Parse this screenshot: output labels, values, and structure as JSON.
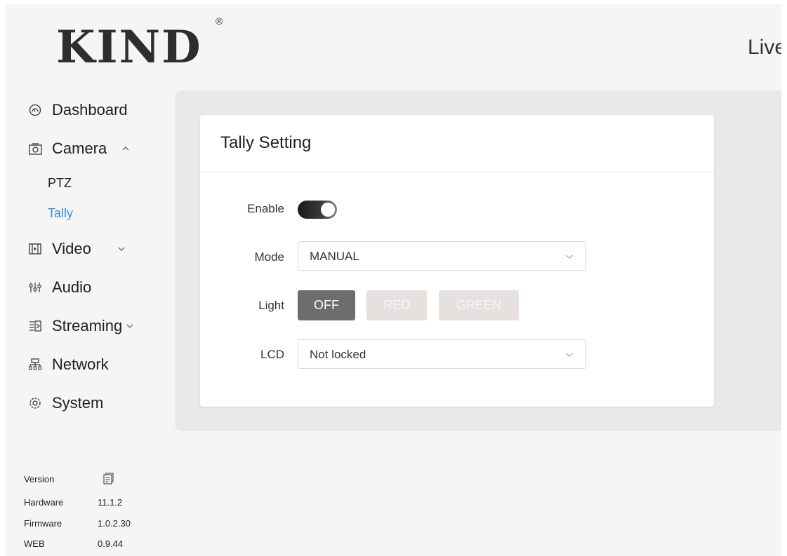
{
  "brand": {
    "name": "KIND",
    "reg": "®"
  },
  "header": {
    "right_text": "Live"
  },
  "sidebar": {
    "items": [
      {
        "label": "Dashboard",
        "icon": "dashboard-icon"
      },
      {
        "label": "Camera",
        "icon": "camera-icon",
        "expanded": true
      },
      {
        "label": "Video",
        "icon": "video-icon"
      },
      {
        "label": "Audio",
        "icon": "audio-icon"
      },
      {
        "label": "Streaming",
        "icon": "streaming-icon"
      },
      {
        "label": "Network",
        "icon": "network-icon"
      },
      {
        "label": "System",
        "icon": "gear-icon"
      }
    ],
    "camera_sub": [
      {
        "label": "PTZ",
        "active": false
      },
      {
        "label": "Tally",
        "active": true
      }
    ]
  },
  "version": {
    "label": "Version",
    "rows": [
      {
        "key": "Hardware",
        "value": "11.1.2"
      },
      {
        "key": "Firmware",
        "value": "1.0.2.30"
      },
      {
        "key": "WEB",
        "value": "0.9.44"
      }
    ]
  },
  "tally": {
    "title": "Tally Setting",
    "enable_label": "Enable",
    "enable_on": true,
    "mode_label": "Mode",
    "mode_value": "MANUAL",
    "light_label": "Light",
    "light_buttons": [
      "OFF",
      "RED",
      "GREEN"
    ],
    "light_selected": "OFF",
    "lcd_label": "LCD",
    "lcd_value": "Not locked"
  },
  "colors": {
    "accent": "#3a8fd6",
    "button_active": "#6d6d6d",
    "button_inactive": "#e6e1df"
  }
}
